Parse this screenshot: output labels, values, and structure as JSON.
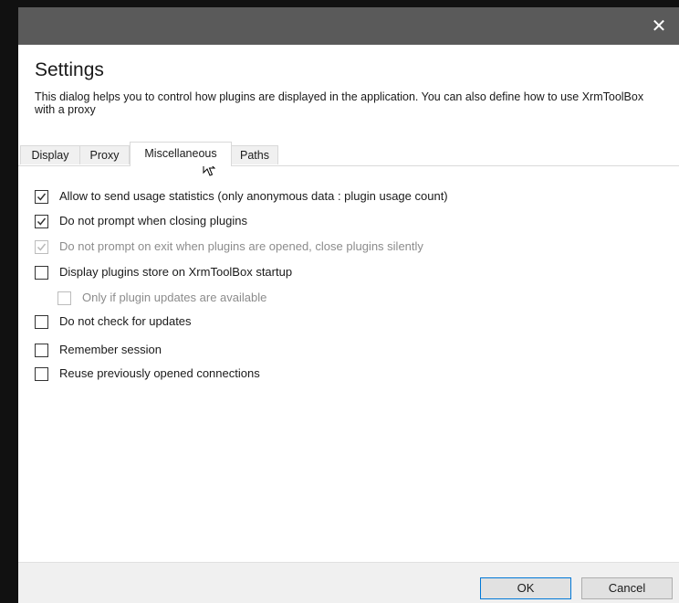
{
  "window": {
    "close_glyph": "✕"
  },
  "header": {
    "title": "Settings",
    "description": "This dialog helps you to control how plugins are displayed in the application. You can also define how to use XrmToolBox with a proxy"
  },
  "tabs": [
    {
      "label": "Display",
      "active": false
    },
    {
      "label": "Proxy",
      "active": false
    },
    {
      "label": "Miscellaneous",
      "active": true
    },
    {
      "label": "Paths",
      "active": false
    }
  ],
  "options": [
    {
      "label": "Allow to send usage statistics (only anonymous data : plugin usage count)",
      "checked": true,
      "enabled": true
    },
    {
      "label": "Do not prompt when closing plugins",
      "checked": true,
      "enabled": true
    },
    {
      "label": "Do not prompt on exit when plugins are opened, close plugins silently",
      "checked": true,
      "enabled": false
    },
    {
      "label": "Display plugins store on XrmToolBox startup",
      "checked": false,
      "enabled": true
    },
    {
      "label": "Only if plugin updates are available",
      "checked": false,
      "enabled": false
    },
    {
      "label": "Do not check for updates",
      "checked": false,
      "enabled": true
    },
    {
      "label": "Remember session",
      "checked": false,
      "enabled": true
    },
    {
      "label": "Reuse previously opened connections",
      "checked": false,
      "enabled": true
    }
  ],
  "footer": {
    "ok_label": "OK",
    "cancel_label": "Cancel"
  },
  "colors": {
    "titlebar": "#5a5a5a",
    "accent": "#0078d7",
    "footer": "#f0f0f0"
  },
  "icons": {
    "close": "close-icon",
    "check": "checkmark-icon",
    "cursor": "mouse-cursor-icon"
  }
}
